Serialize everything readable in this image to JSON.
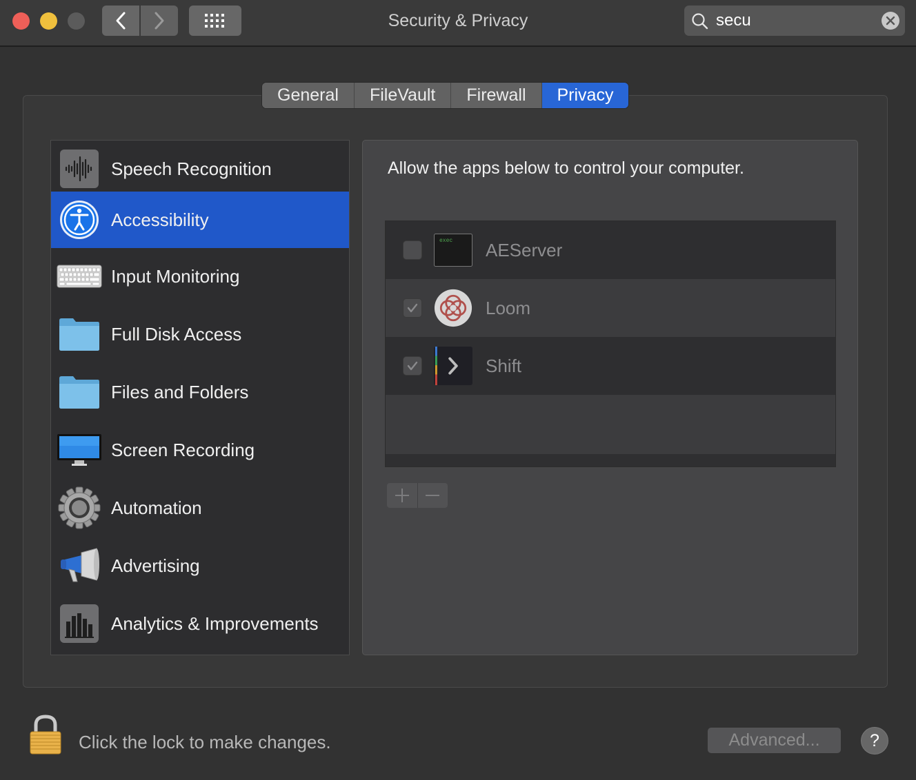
{
  "window": {
    "title": "Security & Privacy"
  },
  "search": {
    "value": "secu"
  },
  "tabs": [
    {
      "label": "General"
    },
    {
      "label": "FileVault"
    },
    {
      "label": "Firewall"
    },
    {
      "label": "Privacy"
    }
  ],
  "active_tab": "Privacy",
  "categories": [
    {
      "label": "Speech Recognition",
      "icon": "waveform-icon"
    },
    {
      "label": "Accessibility",
      "icon": "accessibility-icon"
    },
    {
      "label": "Input Monitoring",
      "icon": "keyboard-icon"
    },
    {
      "label": "Full Disk Access",
      "icon": "folder-icon"
    },
    {
      "label": "Files and Folders",
      "icon": "folder-icon"
    },
    {
      "label": "Screen Recording",
      "icon": "display-icon"
    },
    {
      "label": "Automation",
      "icon": "gear-icon"
    },
    {
      "label": "Advertising",
      "icon": "megaphone-icon"
    },
    {
      "label": "Analytics & Improvements",
      "icon": "bar-chart-icon"
    }
  ],
  "selected_category": "Accessibility",
  "panel": {
    "description": "Allow the apps below to control your computer.",
    "apps": [
      {
        "name": "AEServer",
        "checked": false,
        "icon": "terminal-exec-icon",
        "icon_text": "exec"
      },
      {
        "name": "Loom",
        "checked": true,
        "icon": "loom-icon"
      },
      {
        "name": "Shift",
        "checked": true,
        "icon": "shift-icon"
      }
    ],
    "add_label": "+",
    "remove_label": "—"
  },
  "footer": {
    "lock_text": "Click the lock to make changes.",
    "advanced_label": "Advanced...",
    "help_label": "?"
  },
  "colors": {
    "accent": "#2866d6",
    "selection": "#2058c9",
    "close": "#ee5f58",
    "minimize": "#f0c03d"
  }
}
